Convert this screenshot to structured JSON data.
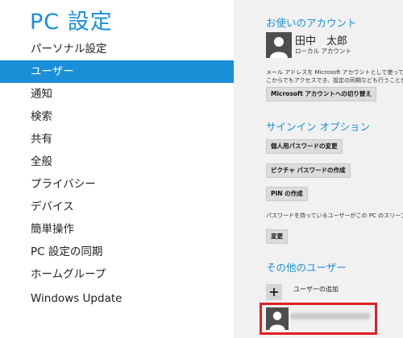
{
  "sidebar": {
    "title": "PC 設定",
    "items": [
      {
        "label": "パーソナル設定"
      },
      {
        "label": "ユーザー"
      },
      {
        "label": "通知"
      },
      {
        "label": "検索"
      },
      {
        "label": "共有"
      },
      {
        "label": "全般"
      },
      {
        "label": "プライバシー"
      },
      {
        "label": "デバイス"
      },
      {
        "label": "簡単操作"
      },
      {
        "label": "PC 設定の同期"
      },
      {
        "label": "ホームグループ"
      },
      {
        "label": "Windows Update"
      }
    ],
    "selected_index": 1
  },
  "account": {
    "heading": "お使いのアカウント",
    "user_name": "田中　太郎",
    "user_type": "ローカル アカウント",
    "description_line1": "メール アドレスを Microsoft アカウントとして使って Windo",
    "description_line2": "こからでもアクセスでき、設定の同期なども行うことができま",
    "switch_button": "Microsoft アカウントへの切り替え"
  },
  "signin": {
    "heading": "サインイン オプション",
    "change_password_button": "個人用パスワードの変更",
    "picture_password_button": "ピクチャ パスワードの作成",
    "pin_button": "PIN の作成",
    "sleep_description": "パスワードを持っているユーザーがこの PC のスリープを解除",
    "change_button": "変更"
  },
  "other_users": {
    "heading": "その他のユーザー",
    "add_user_label": "ユーザーの追加"
  },
  "colors": {
    "accent": "#1a8fd8",
    "highlight_border": "#e02020",
    "right_panel_bg": "#f1f1f1"
  }
}
